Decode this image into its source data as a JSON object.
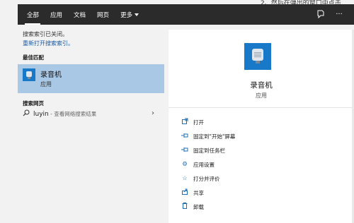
{
  "background_text": "2、然后在弹出的窗口中点击",
  "tabs": [
    {
      "label": "全部",
      "active": true
    },
    {
      "label": "应用",
      "active": false
    },
    {
      "label": "文档",
      "active": false
    },
    {
      "label": "网页",
      "active": false
    },
    {
      "label": "更多",
      "active": false
    }
  ],
  "top_icons": [
    "feedback-icon",
    "more-options-icon"
  ],
  "notice": {
    "line1": "搜索索引已关闭。",
    "line2": "重新打开搜索索引。"
  },
  "best_match": {
    "header": "最佳匹配",
    "title": "录音机",
    "subtitle": "应用",
    "icon": "voice-recorder-icon"
  },
  "web_search": {
    "header": "搜索网页",
    "term": "luyin",
    "hint": " - 查看网络搜索结果"
  },
  "detail": {
    "app_name": "录音机",
    "app_type": "应用",
    "actions": [
      {
        "label": "打开",
        "icon": "open-icon"
      },
      {
        "label": "固定到\"开始\"屏幕",
        "icon": "pin-start-icon"
      },
      {
        "label": "固定到任务栏",
        "icon": "pin-taskbar-icon"
      },
      {
        "label": "应用设置",
        "icon": "settings-icon"
      },
      {
        "label": "打分并评价",
        "icon": "rate-icon"
      },
      {
        "label": "共享",
        "icon": "share-icon"
      },
      {
        "label": "卸载",
        "icon": "uninstall-icon"
      }
    ]
  },
  "colors": {
    "topbar": "#2b2b2b",
    "selection": "#a9c8e6",
    "accent": "#1979c9",
    "link": "#1a5aa6"
  }
}
